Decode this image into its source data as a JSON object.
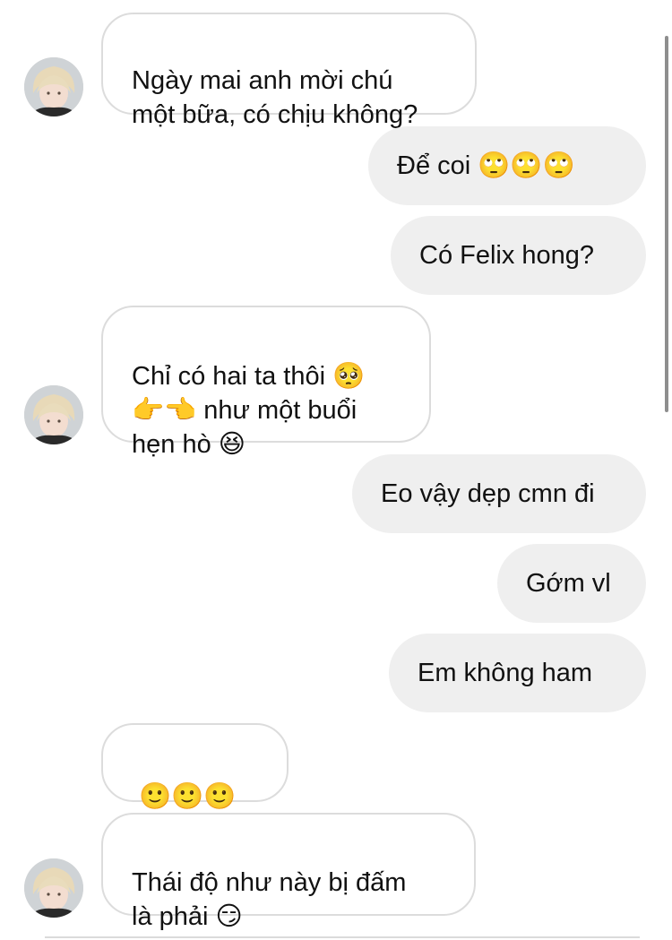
{
  "colors": {
    "incoming_bubble_bg": "#ffffff",
    "incoming_bubble_border": "#dcdcdc",
    "outgoing_bubble_bg": "#efefef",
    "text": "#111111"
  },
  "contact": {
    "avatar_icon": "user-avatar-photo"
  },
  "messages": [
    {
      "direction": "incoming",
      "text": "Ngày mai anh mời chú\nmột bữa, có chịu không?"
    },
    {
      "direction": "outgoing",
      "text": "Để coi 🙄🙄🙄"
    },
    {
      "direction": "outgoing",
      "text": "Có Felix hong?"
    },
    {
      "direction": "incoming",
      "text": "Chỉ có hai ta thôi 🥺\n👉👈 như một buổi\nhẹn hò 😆"
    },
    {
      "direction": "outgoing",
      "text": "Eo vậy dẹp cmn đi"
    },
    {
      "direction": "outgoing",
      "text": "Gớm vl"
    },
    {
      "direction": "outgoing",
      "text": "Em không ham"
    },
    {
      "direction": "incoming",
      "text": "🙂🙂🙂"
    },
    {
      "direction": "incoming",
      "text": "Thái độ như này bị đấm\nlà phải 😏"
    }
  ]
}
